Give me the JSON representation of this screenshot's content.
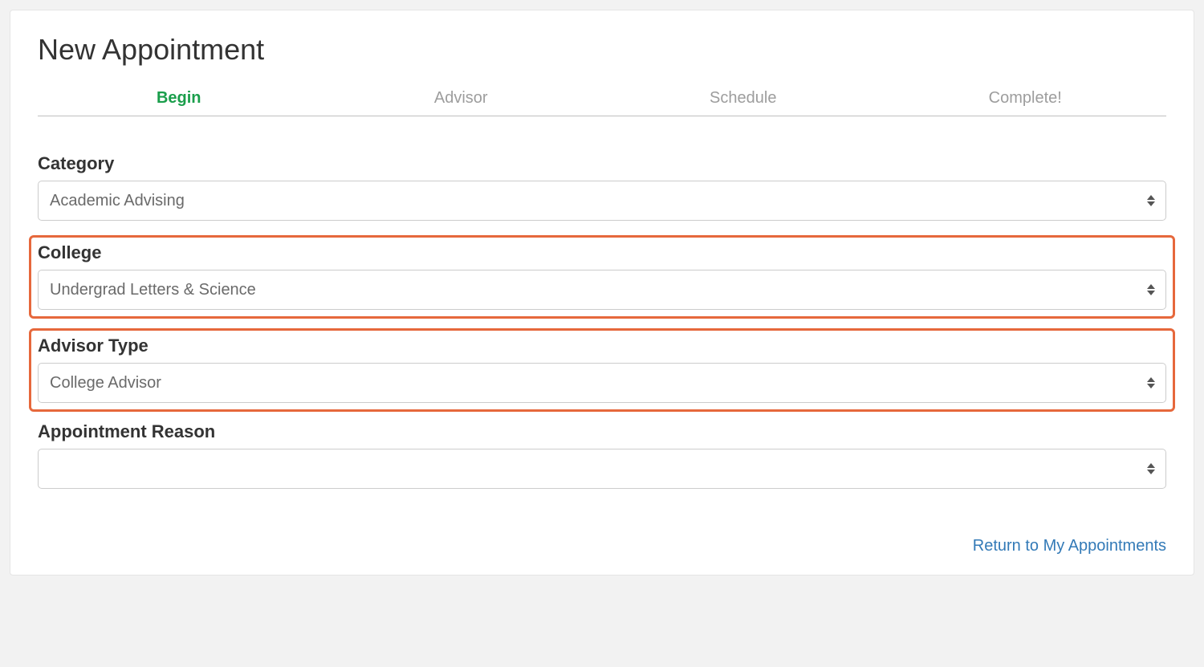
{
  "page": {
    "title": "New Appointment"
  },
  "stepper": {
    "steps": [
      {
        "label": "Begin",
        "active": true
      },
      {
        "label": "Advisor",
        "active": false
      },
      {
        "label": "Schedule",
        "active": false
      },
      {
        "label": "Complete!",
        "active": false
      }
    ]
  },
  "form": {
    "category": {
      "label": "Category",
      "value": "Academic Advising"
    },
    "college": {
      "label": "College",
      "value": "Undergrad Letters & Science"
    },
    "advisor_type": {
      "label": "Advisor Type",
      "value": "College Advisor"
    },
    "appointment_reason": {
      "label": "Appointment Reason",
      "value": ""
    }
  },
  "footer": {
    "return_link": "Return to My Appointments"
  }
}
